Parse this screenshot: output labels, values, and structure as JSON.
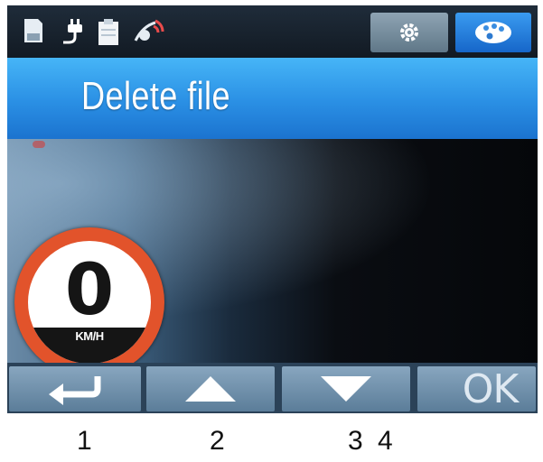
{
  "title_bar": {
    "title": "Delete file"
  },
  "status_bar": {
    "icons": [
      "sd-card-icon",
      "power-plug-icon",
      "clipboard-icon",
      "gps-satellite-icon"
    ],
    "mode_buttons": [
      "gear-icon",
      "palette-icon"
    ]
  },
  "speedometer": {
    "value": "0",
    "unit": "KM/H"
  },
  "softkeys": {
    "back_icon": "return-arrow-icon",
    "up_icon": "triangle-up-icon",
    "down_icon": "triangle-down-icon",
    "ok_label": "OK"
  },
  "button_numbers": {
    "n1": "1",
    "n2": "2",
    "n3": "3",
    "n4": "4"
  },
  "colors": {
    "title_bar": "#2a8fe4",
    "palette_button": "#1e7be0",
    "speedometer_ring": "#e2532b",
    "softkey": "#7495b0"
  }
}
